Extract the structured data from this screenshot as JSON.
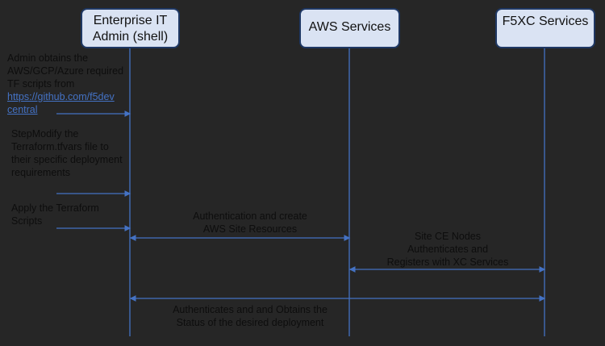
{
  "participants": [
    {
      "label": "Enterprise IT Admin (shell)",
      "line1": "Enterprise IT",
      "line2": "Admin (shell)"
    },
    {
      "label": "AWS Services"
    },
    {
      "label": "F5XC Services"
    }
  ],
  "steps": {
    "step1": {
      "line1": "Admin obtains the",
      "line2": "AWS/GCP/Azure required",
      "line3": "TF scripts from",
      "link_line1": "https://github.com/f5dev",
      "link_line2": "central"
    },
    "step2": {
      "line1": "StepModify the",
      "line2": "Terraform.tfvars file to",
      "line3": "their specific deployment",
      "line4": "requirements"
    },
    "step3": {
      "line1": "Apply the Terraform",
      "line2": "Scripts"
    },
    "msg_aws": {
      "line1": "Authentication and create",
      "line2": "AWS Site Resources"
    },
    "msg_xc": {
      "line1": "Site CE Nodes",
      "line2": "Authenticates and",
      "line3": "Registers with XC Services"
    },
    "msg_status": {
      "line1": "Authenticates and and Obtains the",
      "line2": "Status of the desired deployment"
    }
  },
  "colors": {
    "background": "#262626",
    "line": "#4472c4",
    "box_fill": "#dae3f3",
    "box_border": "#1f3864"
  }
}
